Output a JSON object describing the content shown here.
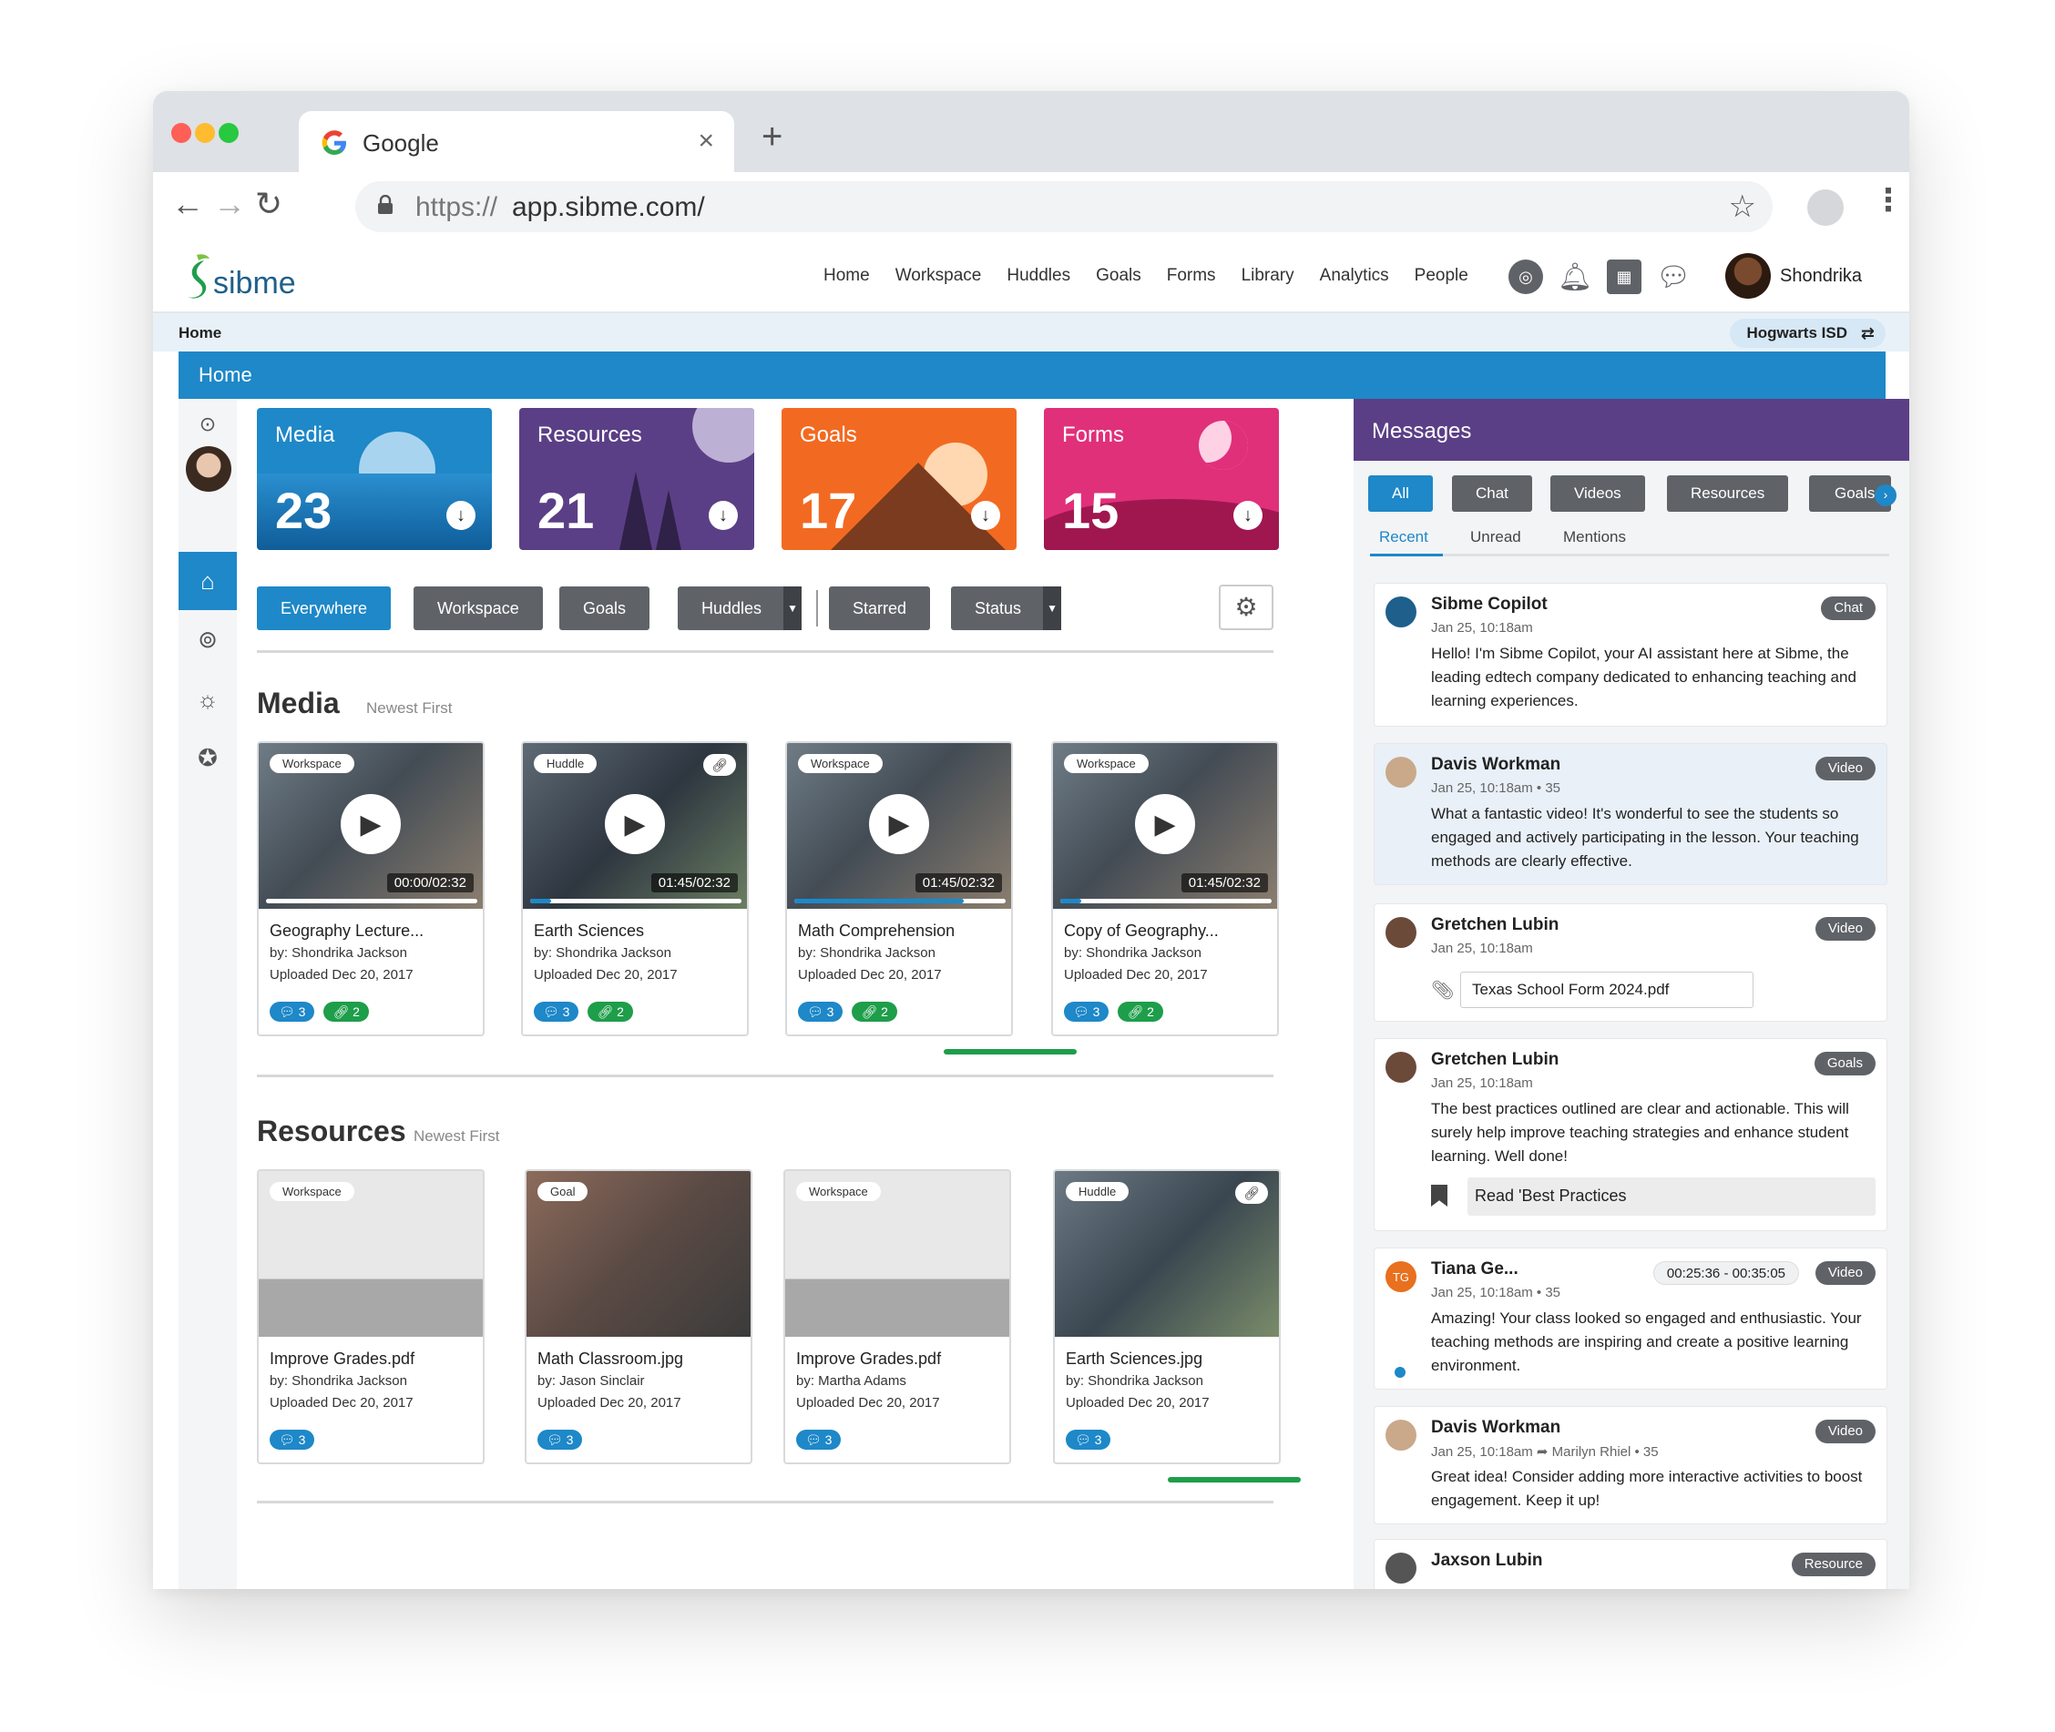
{
  "browser": {
    "tab_title": "Google",
    "url_protocol": "https://",
    "url_host": "app.sibme.com/"
  },
  "app": {
    "logo_text": "sibme",
    "nav": [
      "Home",
      "Workspace",
      "Huddles",
      "Goals",
      "Forms",
      "Library",
      "Analytics",
      "People"
    ],
    "user_name": "Shondrika",
    "breadcrumb": "Home",
    "district": "Hogwarts ISD",
    "page_header": "Home"
  },
  "stats": [
    {
      "title": "Media",
      "count": "23",
      "color": "#1e88c8"
    },
    {
      "title": "Resources",
      "count": "21",
      "color": "#5b3f86"
    },
    {
      "title": "Goals",
      "count": "17",
      "color": "#f26a21"
    },
    {
      "title": "Forms",
      "count": "15",
      "color": "#e0307a"
    }
  ],
  "filters": [
    "Everywhere",
    "Workspace",
    "Goals",
    "Huddles",
    "Starred",
    "Status"
  ],
  "media": {
    "title": "Media",
    "sort": "Newest First",
    "items": [
      {
        "tag": "Workspace",
        "name": "Geography Lecture...",
        "by": "by: Shondrika Jackson",
        "uploaded": "Uploaded Dec 20, 2017",
        "duration": "00:00/02:32",
        "progress": 0,
        "comments": "3",
        "links": "2"
      },
      {
        "tag": "Huddle",
        "name": "Earth Sciences",
        "by": "by: Shondrika Jackson",
        "uploaded": "Uploaded Dec 20, 2017",
        "duration": "01:45/02:32",
        "progress": 0.1,
        "comments": "3",
        "links": "2"
      },
      {
        "tag": "Workspace",
        "name": "Math Comprehension",
        "by": "by: Shondrika Jackson",
        "uploaded": "Uploaded Dec 20, 2017",
        "duration": "01:45/02:32",
        "progress": 0.8,
        "comments": "3",
        "links": "2"
      },
      {
        "tag": "Workspace",
        "name": "Copy of Geography...",
        "by": "by: Shondrika Jackson",
        "uploaded": "Uploaded Dec 20, 2017",
        "duration": "01:45/02:32",
        "progress": 0.1,
        "comments": "3",
        "links": "2"
      }
    ]
  },
  "resources": {
    "title": "Resources",
    "sort": "Newest First",
    "items": [
      {
        "tag": "Workspace",
        "name": "Improve Grades.pdf",
        "by": "by: Shondrika Jackson",
        "uploaded": "Uploaded Dec 20, 2017",
        "comments": "3"
      },
      {
        "tag": "Goal",
        "name": "Math Classroom.jpg",
        "by": "by: Jason Sinclair",
        "uploaded": "Uploaded Dec 20, 2017",
        "comments": "3"
      },
      {
        "tag": "Workspace",
        "name": "Improve Grades.pdf",
        "by": "by: Martha Adams",
        "uploaded": "Uploaded Dec 20, 2017",
        "comments": "3"
      },
      {
        "tag": "Huddle",
        "name": "Earth Sciences.jpg",
        "by": "by: Shondrika Jackson",
        "uploaded": "Uploaded Dec 20, 2017",
        "comments": "3"
      }
    ]
  },
  "messages": {
    "title": "Messages",
    "tabs": [
      "All",
      "Chat",
      "Videos",
      "Resources",
      "Goals"
    ],
    "subtabs": [
      "Recent",
      "Unread",
      "Mentions"
    ],
    "items": [
      {
        "name": "Sibme Copilot",
        "time": "Jan 25, 10:18am",
        "badge": "Chat",
        "body": "Hello! I'm Sibme Copilot, your AI assistant here at Sibme, the leading edtech company dedicated to enhancing teaching and learning experiences."
      },
      {
        "name": "Davis Workman",
        "time": "Jan 25, 10:18am • 35",
        "badge": "Video",
        "body": "What a fantastic video! It's wonderful to see the students so engaged and actively participating in the lesson. Your teaching methods are clearly effective."
      },
      {
        "name": "Gretchen Lubin",
        "time": "Jan 25, 10:18am",
        "badge": "Video",
        "file": "Texas School Form 2024.pdf"
      },
      {
        "name": "Gretchen Lubin",
        "time": "Jan 25, 10:18am",
        "badge": "Goals",
        "body": "The best practices outlined are clear and actionable. This will surely help improve teaching strategies and enhance student learning. Well done!",
        "action": "Read 'Best Practices"
      },
      {
        "name": "Tiana Ge...",
        "initials": "TG",
        "time": "Jan 25, 10:18am • 35",
        "badge": "Video",
        "range": "00:25:36 - 00:35:05",
        "body": "Amazing! Your class looked so engaged and enthusiastic. Your teaching methods are inspiring and create a positive learning environment."
      },
      {
        "name": "Davis Workman",
        "time": "Jan 25, 10:18am ➦ Marilyn Rhiel • 35",
        "badge": "Video",
        "body": "Great idea! Consider adding more interactive activities to boost engagement. Keep it up!"
      },
      {
        "name": "Jaxson Lubin",
        "badge": "Resource"
      }
    ]
  }
}
